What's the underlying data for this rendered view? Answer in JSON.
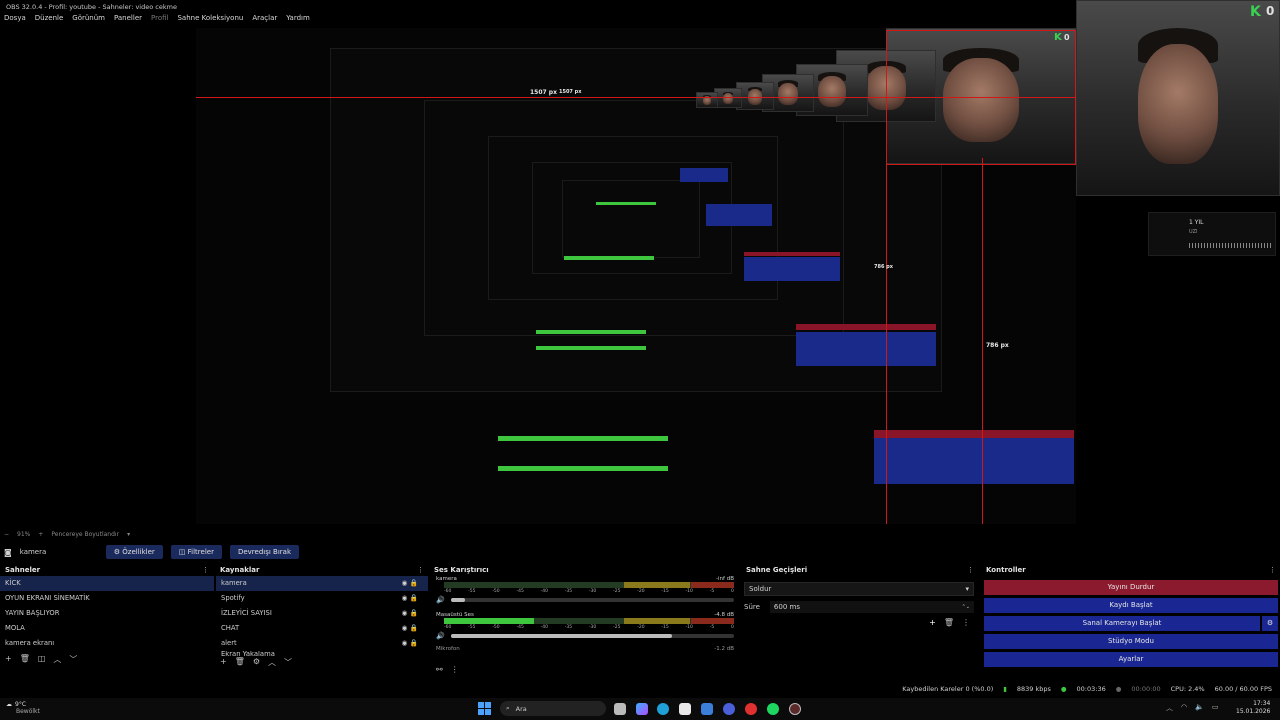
{
  "window": {
    "title": "OBS 32.0.4 - Profil: youtube - Sahneler: video cekme"
  },
  "menu": {
    "items": [
      "Dosya",
      "Düzenle",
      "Görünüm",
      "Paneller",
      "Profil",
      "Sahne Koleksiyonu",
      "Araçlar",
      "Yardım"
    ]
  },
  "preview": {
    "measure_horizontal": "1507 px",
    "measure_horizontal_2": "1507 px",
    "measure_vertical": "786 px",
    "measure_vertical_2": "786 px",
    "badge_count": "0",
    "notif_title": "1 YIL",
    "notif_sub": "UZI"
  },
  "toolbar": {
    "zoom": "91%",
    "zoom_mode": "Pencereye Boyutlandır",
    "source_name": "kamera",
    "properties_label": "Özellikler",
    "filters_label": "Filtreler",
    "deactivate_label": "Devredışı Bırak"
  },
  "scenes": {
    "title": "Sahneler",
    "items": [
      "KİCK",
      "OYUN EKRANI SİNEMATİK",
      "YAYIN BAŞLIYOR",
      "MOLA",
      "kamera ekranı"
    ]
  },
  "sources": {
    "title": "Kaynaklar",
    "items": [
      "kamera",
      "Spotify",
      "İZLEYİCİ SAYISI",
      "CHAT",
      "alert",
      "Ekran Yakalama"
    ]
  },
  "mixer": {
    "title": "Ses Karıştırıcı",
    "channels": [
      {
        "name": "kamera",
        "db": "-inf dB",
        "level": 0.0,
        "volume": 0.05
      },
      {
        "name": "Masaüstü Ses",
        "db": "-4.8 dB",
        "level": 0.31,
        "volume": 0.78
      },
      {
        "name": "Mikrofon",
        "db": "-1.2 dB"
      }
    ],
    "scale": [
      "-60",
      "-55",
      "-50",
      "-45",
      "-40",
      "-35",
      "-30",
      "-25",
      "-20",
      "-15",
      "-10",
      "-5",
      "0"
    ]
  },
  "transitions": {
    "title": "Sahne Geçişleri",
    "selected": "Soldur",
    "duration_label": "Süre",
    "duration_value": "600 ms"
  },
  "controls": {
    "title": "Kontroller",
    "buttons": [
      "Yayını Durdur",
      "Kaydı Başlat",
      "Sanal Kamerayı Başlat",
      "Stüdyo Modu",
      "Ayarlar"
    ]
  },
  "status": {
    "dropped": "Kaybedilen Kareler 0 (%0.0)",
    "bitrate": "8839 kbps",
    "live_time": "00:03:36",
    "rec_time": "00:00:00",
    "cpu": "CPU: 2.4%",
    "fps": "60.00 / 60.00 FPS"
  },
  "taskbar": {
    "weather_temp": "9°C",
    "weather_desc": "Bewölkt",
    "search": "Ara",
    "time": "17:34",
    "date": "15.01.2026"
  },
  "colors": {
    "accent_blue": "#1a2792",
    "accent_red": "#8c1a2e",
    "guide_red": "#d01818",
    "meter_green": "#3ec63e"
  }
}
